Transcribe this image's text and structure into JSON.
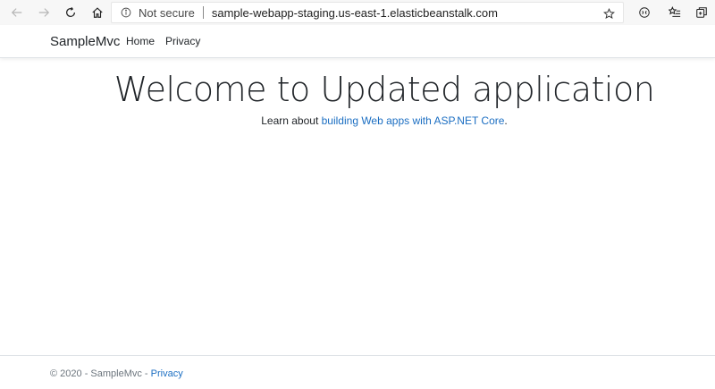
{
  "browser": {
    "nav": {
      "back_icon": "back-arrow-icon",
      "forward_icon": "forward-arrow-icon",
      "refresh_icon": "refresh-icon",
      "home_icon": "home-icon"
    },
    "address_bar": {
      "security_label": "Not secure",
      "url": "sample-webapp-staging.us-east-1.elasticbeanstalk.com"
    },
    "tools": [
      "favorite-star-icon",
      "reading-view-icon",
      "favorites-list-icon",
      "collections-icon"
    ]
  },
  "site": {
    "brand": "SampleMvc",
    "nav_links": [
      {
        "label": "Home"
      },
      {
        "label": "Privacy"
      }
    ]
  },
  "main": {
    "title": "Welcome to Updated application",
    "learn_prefix": "Learn about ",
    "learn_link": "building Web apps with ASP.NET Core",
    "learn_suffix": "."
  },
  "footer": {
    "copyright": "© 2020 - SampleMvc - ",
    "privacy_link": "Privacy"
  },
  "colors": {
    "link": "#1b6ec2",
    "text": "#212529",
    "muted": "#6c757d",
    "browser_bar": "#f7f7f7"
  }
}
